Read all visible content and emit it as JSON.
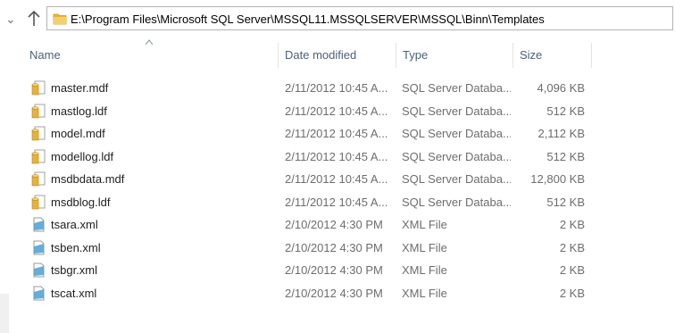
{
  "address_bar": {
    "path": "E:\\Program Files\\Microsoft SQL Server\\MSSQL11.MSSQLSERVER\\MSSQL\\Binn\\Templates"
  },
  "columns": {
    "name": "Name",
    "date_modified": "Date modified",
    "type": "Type",
    "size": "Size"
  },
  "files": [
    {
      "name": "master.mdf",
      "date": "2/11/2012 10:45 A...",
      "type": "SQL Server Databa...",
      "size": "4,096 KB",
      "icon": "sql-db-file-icon"
    },
    {
      "name": "mastlog.ldf",
      "date": "2/11/2012 10:45 A...",
      "type": "SQL Server Databa...",
      "size": "512 KB",
      "icon": "sql-db-file-icon"
    },
    {
      "name": "model.mdf",
      "date": "2/11/2012 10:45 A...",
      "type": "SQL Server Databa...",
      "size": "2,112 KB",
      "icon": "sql-db-file-icon"
    },
    {
      "name": "modellog.ldf",
      "date": "2/11/2012 10:45 A...",
      "type": "SQL Server Databa...",
      "size": "512 KB",
      "icon": "sql-db-file-icon"
    },
    {
      "name": "msdbdata.mdf",
      "date": "2/11/2012 10:45 A...",
      "type": "SQL Server Databa...",
      "size": "12,800 KB",
      "icon": "sql-db-file-icon"
    },
    {
      "name": "msdblog.ldf",
      "date": "2/11/2012 10:45 A...",
      "type": "SQL Server Databa...",
      "size": "512 KB",
      "icon": "sql-db-file-icon"
    },
    {
      "name": "tsara.xml",
      "date": "2/10/2012 4:30 PM",
      "type": "XML File",
      "size": "2 KB",
      "icon": "xml-file-icon"
    },
    {
      "name": "tsben.xml",
      "date": "2/10/2012 4:30 PM",
      "type": "XML File",
      "size": "2 KB",
      "icon": "xml-file-icon"
    },
    {
      "name": "tsbgr.xml",
      "date": "2/10/2012 4:30 PM",
      "type": "XML File",
      "size": "2 KB",
      "icon": "xml-file-icon"
    },
    {
      "name": "tscat.xml",
      "date": "2/10/2012 4:30 PM",
      "type": "XML File",
      "size": "2 KB",
      "icon": "xml-file-icon"
    }
  ],
  "colors": {
    "header_text": "#4c607a",
    "folder_yellow": "#e8b23a",
    "xml_icon": "#4a9fd4"
  }
}
